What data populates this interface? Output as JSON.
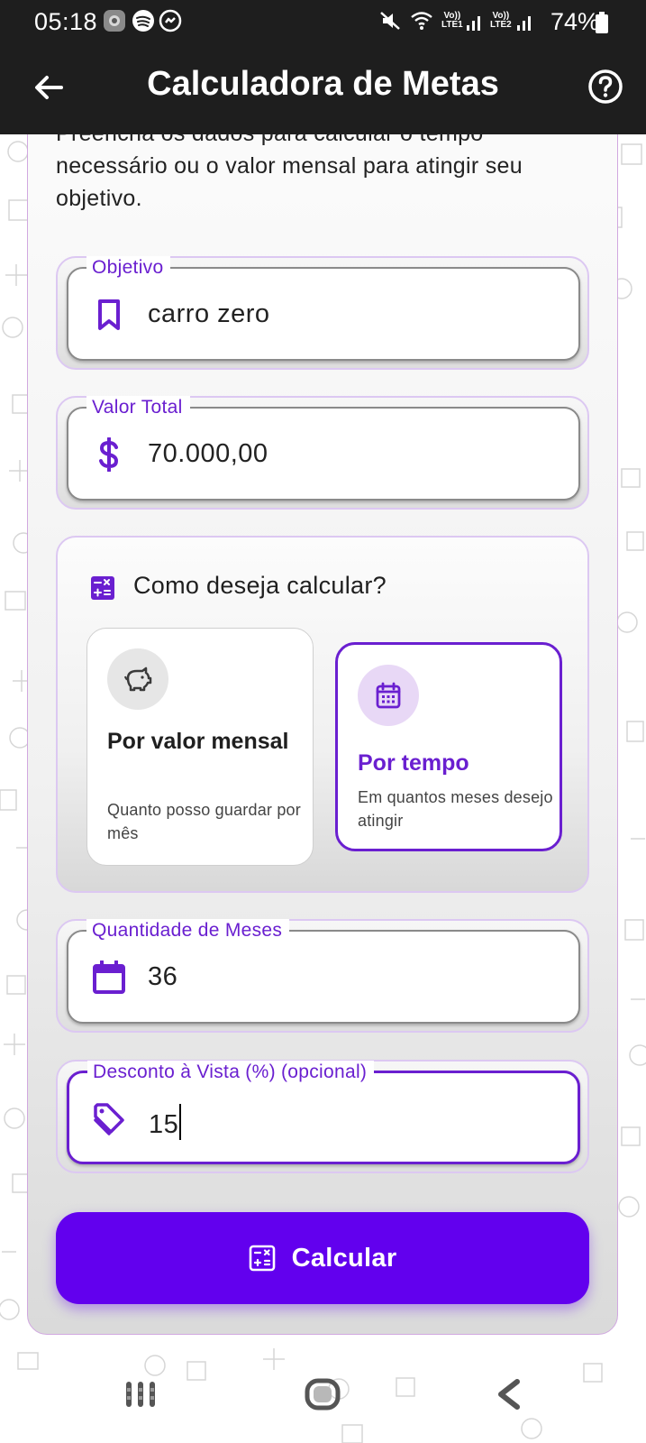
{
  "status_bar": {
    "time": "05:18",
    "battery": "74%",
    "network1": [
      "Vo))",
      "LTE1"
    ],
    "network2": [
      "Vo))",
      "LTE2"
    ],
    "left_icons": [
      "gallery-app-icon",
      "spotify-icon",
      "messenger-icon"
    ],
    "right_icons": [
      "mute-icon",
      "wifi-icon",
      "signal-icon",
      "battery-icon"
    ]
  },
  "app_bar": {
    "title": "Calculadora de Metas",
    "back_icon": "arrow-back-icon",
    "help_icon": "help-circle-icon"
  },
  "intro": {
    "text_partial_line": "Preencha os dados para calcular o tempo",
    "text": "necessário ou o valor mensal para atingir seu objetivo."
  },
  "fields": {
    "objetivo": {
      "label": "Objetivo",
      "value": "carro zero",
      "icon": "bookmark-icon"
    },
    "valor_total": {
      "label": "Valor Total",
      "value": "70.000,00",
      "icon": "dollar-icon"
    },
    "meses": {
      "label": "Quantidade de Meses",
      "value": "36",
      "icon": "calendar-icon"
    },
    "desconto": {
      "label": "Desconto à Vista (%) (opcional)",
      "value": "15",
      "icon": "tag-icon"
    }
  },
  "method": {
    "title": "Como deseja calcular?",
    "icon": "calculator-icon",
    "options": [
      {
        "title": "Por valor mensal",
        "description": "Quanto posso guardar por mês",
        "icon": "piggy-bank-icon",
        "selected": false
      },
      {
        "title": "Por tempo",
        "description": "Em quantos meses desejo atingir",
        "icon": "calendar-month-icon",
        "selected": true
      }
    ]
  },
  "calc_button": {
    "label": "Calcular",
    "icon": "calculator-icon"
  },
  "nav_bar": {
    "buttons": [
      "recent-apps-icon",
      "home-icon",
      "back-icon"
    ]
  },
  "colors": {
    "accent": "#6200ee",
    "accent_text": "#6a1fd0",
    "appbar": "#1e1e1e",
    "card_border": "#d1a8e0"
  }
}
